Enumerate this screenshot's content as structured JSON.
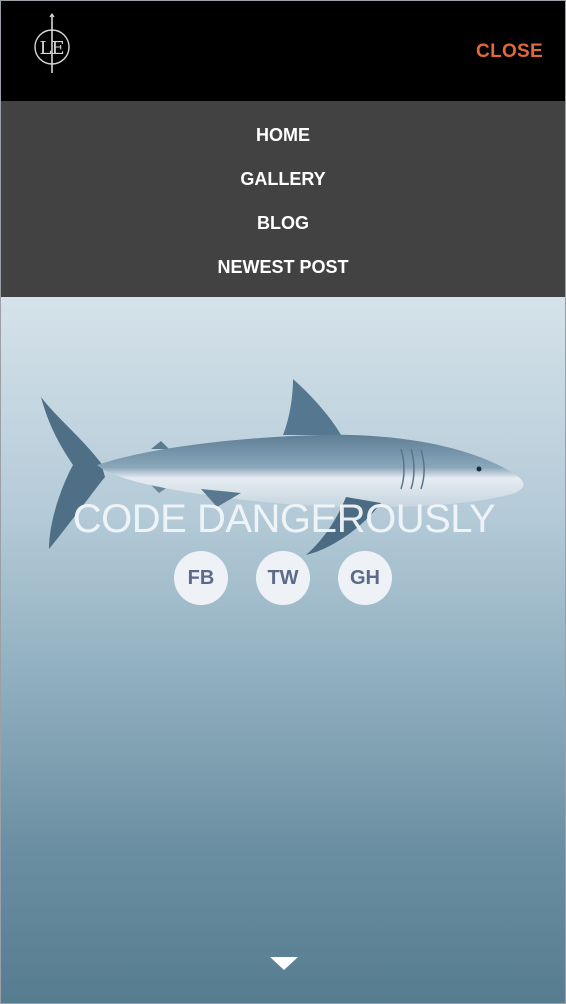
{
  "header": {
    "logo_text": "LE",
    "close_label": "CLOSE"
  },
  "menu": {
    "items": [
      {
        "label": "HOME"
      },
      {
        "label": "GALLERY"
      },
      {
        "label": "BLOG"
      },
      {
        "label": "NEWEST POST"
      }
    ]
  },
  "hero": {
    "tagline": "CODE DANGEROUSLY",
    "socials": [
      {
        "label": "FB"
      },
      {
        "label": "TW"
      },
      {
        "label": "GH"
      }
    ],
    "scroll_icon": "chevron-down-icon"
  },
  "colors": {
    "accent": "#e0693a",
    "menu_bg": "#424242",
    "topbar_bg": "#000000"
  }
}
